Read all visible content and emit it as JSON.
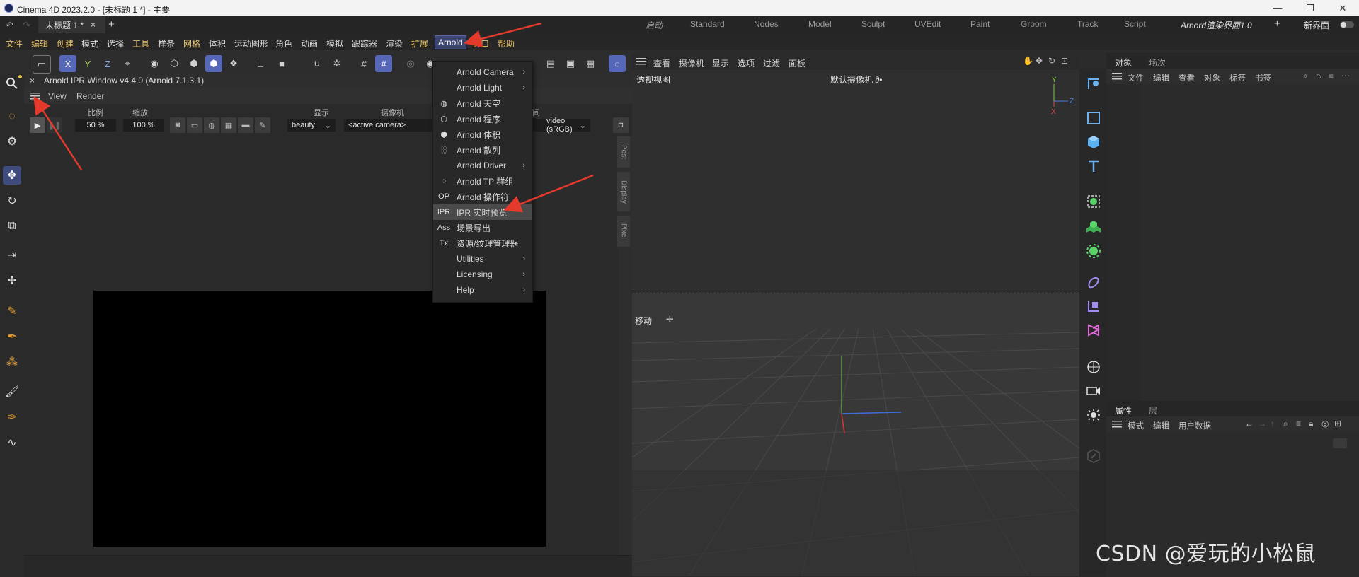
{
  "window": {
    "title": "Cinema 4D 2023.2.0 - [未标题 1 *] - 主要",
    "minimize": "—",
    "maximize": "❐",
    "close": "✕"
  },
  "tabbar": {
    "doc_tab": "未标题 1 *",
    "doc_close": "×",
    "add": "+",
    "layouts": [
      "启动",
      "Standard",
      "Nodes",
      "Model",
      "Sculpt",
      "UVEdit",
      "Paint",
      "Groom",
      "Track",
      "Script",
      "Arnord渲染界面1.0"
    ],
    "add_layout": "+",
    "new_interface": "新界面"
  },
  "menubar": {
    "items": [
      "文件",
      "编辑",
      "创建",
      "模式",
      "选择",
      "工具",
      "样条",
      "网格",
      "体积",
      "运动图形",
      "角色",
      "动画",
      "模拟",
      "跟踪器",
      "渲染",
      "扩展",
      "Arnold",
      "窗口",
      "帮助"
    ]
  },
  "ipr": {
    "title": "Arnold IPR Window v4.4.0 (Arnold 7.1.3.1)",
    "close": "×",
    "menus": [
      "View",
      "Render"
    ],
    "labels": {
      "scale": "比例",
      "zoom": "缩放",
      "display": "显示",
      "camera": "摄像机",
      "view_suffix": "间"
    },
    "scale_value": "50 %",
    "zoom_value": "100 %",
    "display_value": "beauty",
    "camera_value": "<active camera>",
    "view_value": "video (sRGB)",
    "side_tabs": [
      "Post",
      "Display",
      "Pixel"
    ]
  },
  "dropdown": {
    "items": [
      {
        "icon": "",
        "label": "Arnold Camera",
        "arrow": "›"
      },
      {
        "icon": "",
        "label": "Arnold Light",
        "arrow": "›"
      },
      {
        "icon": "◍",
        "label": "Arnold 天空",
        "arrow": ""
      },
      {
        "icon": "⬡",
        "label": "Arnold 程序",
        "arrow": ""
      },
      {
        "icon": "⬢",
        "label": "Arnold 体积",
        "arrow": ""
      },
      {
        "icon": "░",
        "label": "Arnold 散列",
        "arrow": ""
      },
      {
        "icon": "",
        "label": "Arnold Driver",
        "arrow": "›"
      },
      {
        "icon": "⁘",
        "label": "Arnold TP 群组",
        "arrow": ""
      },
      {
        "icon": "OP",
        "label": "Arnold 操作符",
        "arrow": ""
      },
      {
        "icon": "IPR",
        "label": "IPR 实时预览",
        "arrow": ""
      },
      {
        "icon": "Ass",
        "label": "场景导出",
        "arrow": ""
      },
      {
        "icon": "Tx",
        "label": "资源/纹理管理器",
        "arrow": ""
      },
      {
        "icon": "",
        "label": "Utilities",
        "arrow": "›"
      },
      {
        "icon": "",
        "label": "Licensing",
        "arrow": "›"
      },
      {
        "icon": "",
        "label": "Help",
        "arrow": "›"
      }
    ]
  },
  "viewport": {
    "menus": [
      "查看",
      "摄像机",
      "显示",
      "选项",
      "过滤",
      "面板"
    ],
    "view_name": "透视视图",
    "camera_name": "默认摄像机 ∂•",
    "move_label": "移动",
    "axis": {
      "y": "Y",
      "z": "Z",
      "x": "X"
    }
  },
  "object_manager": {
    "tabs": [
      "对象",
      "场次"
    ],
    "menus": [
      "文件",
      "编辑",
      "查看",
      "对象",
      "标签",
      "书签"
    ]
  },
  "attributes": {
    "tabs": [
      "属性",
      "层"
    ],
    "menus": [
      "模式",
      "编辑",
      "用户数据"
    ]
  },
  "watermark": "CSDN @爱玩的小松鼠",
  "colors": {
    "accent": "#5767b7",
    "menu_yellow": "#e8c46a",
    "arrow_red": "#e33a2c"
  }
}
